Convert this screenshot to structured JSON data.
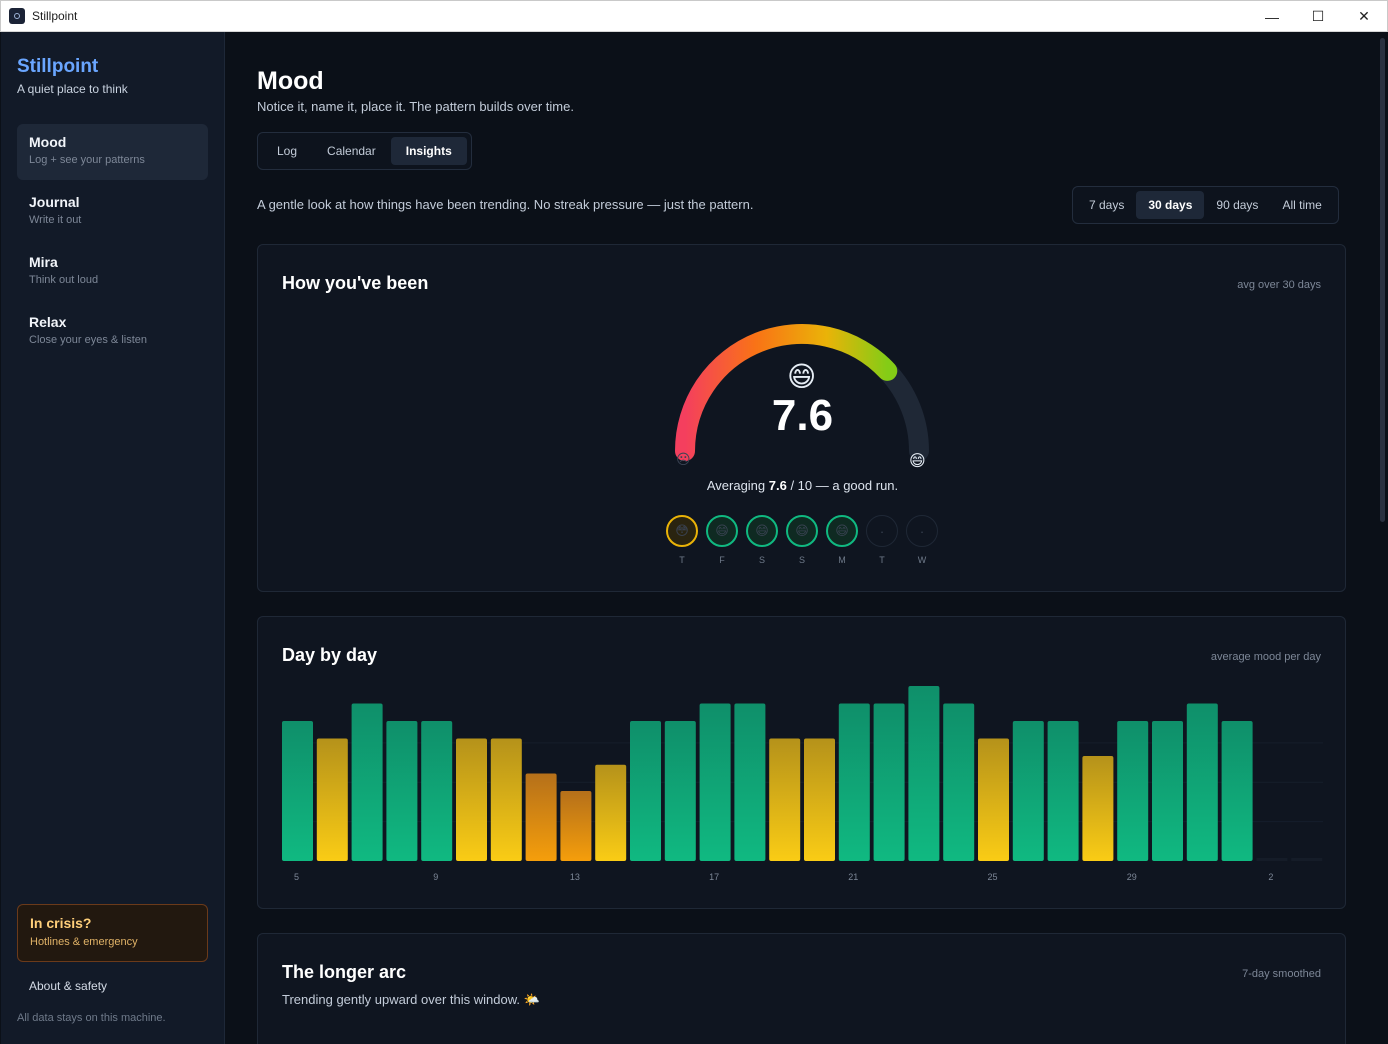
{
  "window": {
    "title": "Stillpoint",
    "minimize": "—",
    "maximize": "☐",
    "close": "✕"
  },
  "sidebar": {
    "brand": "Stillpoint",
    "tagline": "A quiet place to think",
    "items": [
      {
        "label": "Mood",
        "sub": "Log + see your patterns",
        "active": true
      },
      {
        "label": "Journal",
        "sub": "Write it out"
      },
      {
        "label": "Mira",
        "sub": "Think out loud"
      },
      {
        "label": "Relax",
        "sub": "Close your eyes & listen"
      }
    ],
    "crisis": {
      "title": "In crisis?",
      "sub": "Hotlines & emergency"
    },
    "about": "About & safety",
    "footer": "All data stays on this machine."
  },
  "page": {
    "title": "Mood",
    "subtitle": "Notice it, name it, place it. The pattern builds over time.",
    "tabs": [
      "Log",
      "Calendar",
      "Insights"
    ],
    "active_tab": "Insights",
    "intro": "A gentle look at how things have been trending. No streak pressure — just the pattern.",
    "ranges": [
      "7 days",
      "30 days",
      "90 days",
      "All time"
    ],
    "active_range": "30 days"
  },
  "gauge_card": {
    "title": "How you've been",
    "meta": "avg over 30 days",
    "value": "7.6",
    "value_fraction": 0.76,
    "emoji": "😄",
    "low_emoji": "☹",
    "high_emoji": "😄",
    "avg_prefix": "Averaging ",
    "avg_value": "7.6",
    "avg_suffix": " / 10 — a good run.",
    "week": [
      {
        "label": "T",
        "emoji": "😳",
        "state": "today"
      },
      {
        "label": "F",
        "emoji": "😄",
        "state": "good"
      },
      {
        "label": "S",
        "emoji": "😄",
        "state": "good"
      },
      {
        "label": "S",
        "emoji": "😄",
        "state": "good"
      },
      {
        "label": "M",
        "emoji": "😄",
        "state": "good"
      },
      {
        "label": "T",
        "emoji": "·",
        "state": "empty"
      },
      {
        "label": "W",
        "emoji": "·",
        "state": "empty"
      }
    ],
    "colors": {
      "good": "#10b981",
      "today": "#eab308",
      "track": "#1f2836"
    }
  },
  "daybyday_card": {
    "title": "Day by day",
    "meta": "average mood per day"
  },
  "chart_data": {
    "type": "bar",
    "categories": [
      "5",
      "6",
      "7",
      "8",
      "9",
      "10",
      "11",
      "12",
      "13",
      "14",
      "15",
      "16",
      "17",
      "18",
      "19",
      "20",
      "21",
      "22",
      "23",
      "24",
      "25",
      "26",
      "27",
      "28",
      "29",
      "30",
      "31",
      "1",
      "2",
      "3"
    ],
    "values": [
      8,
      7,
      9,
      8,
      8,
      7,
      7,
      5,
      4,
      5.5,
      8,
      8,
      9,
      9,
      7,
      7,
      9,
      9,
      10,
      9,
      7,
      8,
      8,
      6,
      8,
      8,
      9,
      8,
      0,
      0
    ],
    "tick_labels": [
      "5",
      "9",
      "13",
      "17",
      "21",
      "25",
      "29",
      "2"
    ],
    "ylim": [
      0,
      10
    ],
    "colors": {
      "high": "#10b981",
      "mid": "#eab308",
      "low": "#f59e0b"
    }
  },
  "arc_card": {
    "title": "The longer arc",
    "meta": "7-day smoothed",
    "sub": "Trending gently upward over this window. 🌤️"
  }
}
